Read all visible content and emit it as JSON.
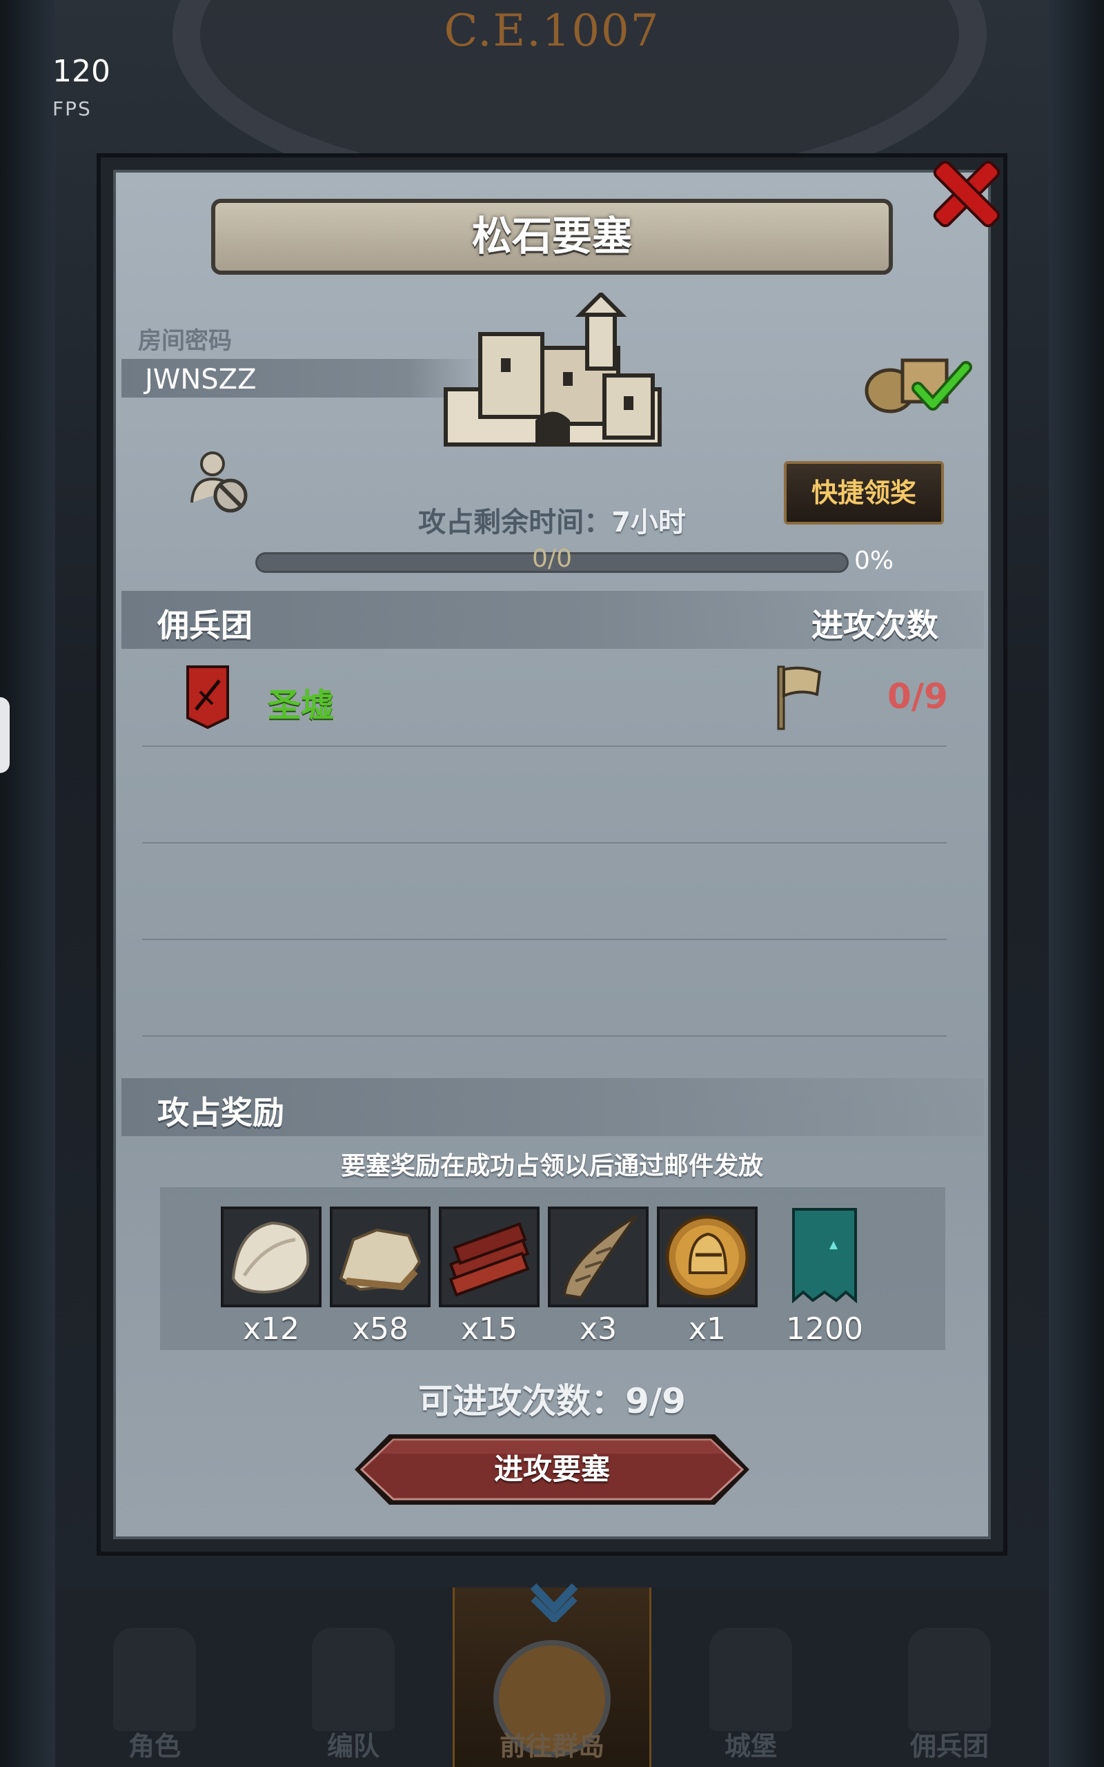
{
  "header": {
    "era": "C.E.1007"
  },
  "fps": {
    "value": "120",
    "label": "FPS"
  },
  "fortress": {
    "title": "松石要塞",
    "room_label": "房间密码",
    "room_code": "JWNSZZ",
    "quick_claim_label": "快捷领奖",
    "remaining_label": "攻占剩余时间：",
    "remaining_value": "7小时",
    "progress_text": "0/0",
    "progress_percent": "0%",
    "progress_fraction": 0
  },
  "mercenary": {
    "section_title": "佣兵团",
    "attack_count_header": "进攻次数",
    "guild_name": "圣墟",
    "attack_count": "0/9"
  },
  "rewards": {
    "section_title": "攻占奖励",
    "note": "要塞奖励在成功占领以后通过邮件发放",
    "items": [
      {
        "icon": "fur-icon",
        "qty": "x12"
      },
      {
        "icon": "hide-icon",
        "qty": "x58"
      },
      {
        "icon": "wood-planks-icon",
        "qty": "x15"
      },
      {
        "icon": "horn-icon",
        "qty": "x3"
      },
      {
        "icon": "knight-helmet-coin-icon",
        "qty": "x1"
      },
      {
        "icon": "guild-banner-icon",
        "qty": "1200"
      }
    ]
  },
  "attempts": {
    "label": "可进攻次数：",
    "value": "9/9"
  },
  "attack_button_label": "进攻要塞",
  "nav": {
    "items": [
      {
        "label": "角色"
      },
      {
        "label": "编队"
      },
      {
        "label": "前往群岛"
      },
      {
        "label": "城堡"
      },
      {
        "label": "佣兵团"
      }
    ]
  },
  "colors": {
    "close": "#c21818",
    "guild_name": "#57c12c",
    "attack_count": "#d65a5a",
    "quick_claim_text": "#f3c867",
    "attack_button": "#7a2f2c"
  }
}
